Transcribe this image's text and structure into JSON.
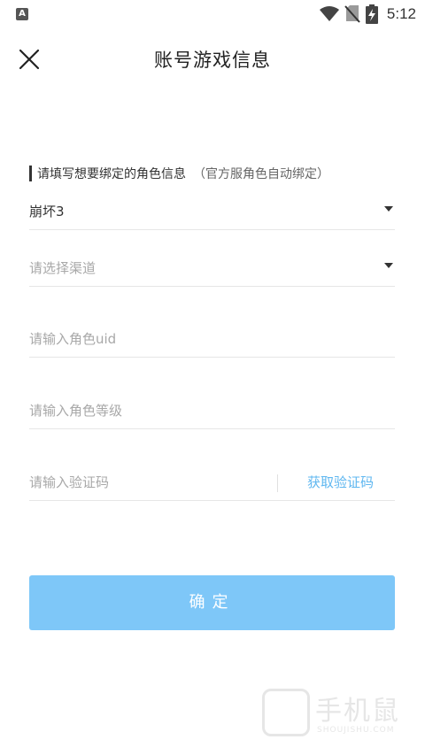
{
  "status_bar": {
    "app_badge": "A",
    "time": "5:12",
    "icons": [
      "wifi-icon",
      "no-sim-icon",
      "battery-charging-icon"
    ]
  },
  "header": {
    "title": "账号游戏信息",
    "close_icon": "close-icon"
  },
  "form": {
    "section_title": "请填写想要绑定的角色信息",
    "section_note": "（官方服角色自动绑定）",
    "game_select_value": "崩坏3",
    "channel_placeholder": "请选择渠道",
    "uid_placeholder": "请输入角色uid",
    "level_placeholder": "请输入角色等级",
    "code_placeholder": "请输入验证码",
    "get_code_label": "获取验证码",
    "confirm_label": "确定"
  },
  "watermark": {
    "text": "手机鼠",
    "sub": "SHOUJISHU.COM"
  },
  "colors": {
    "accent": "#7ec7f8",
    "link": "#5fb7f0"
  }
}
